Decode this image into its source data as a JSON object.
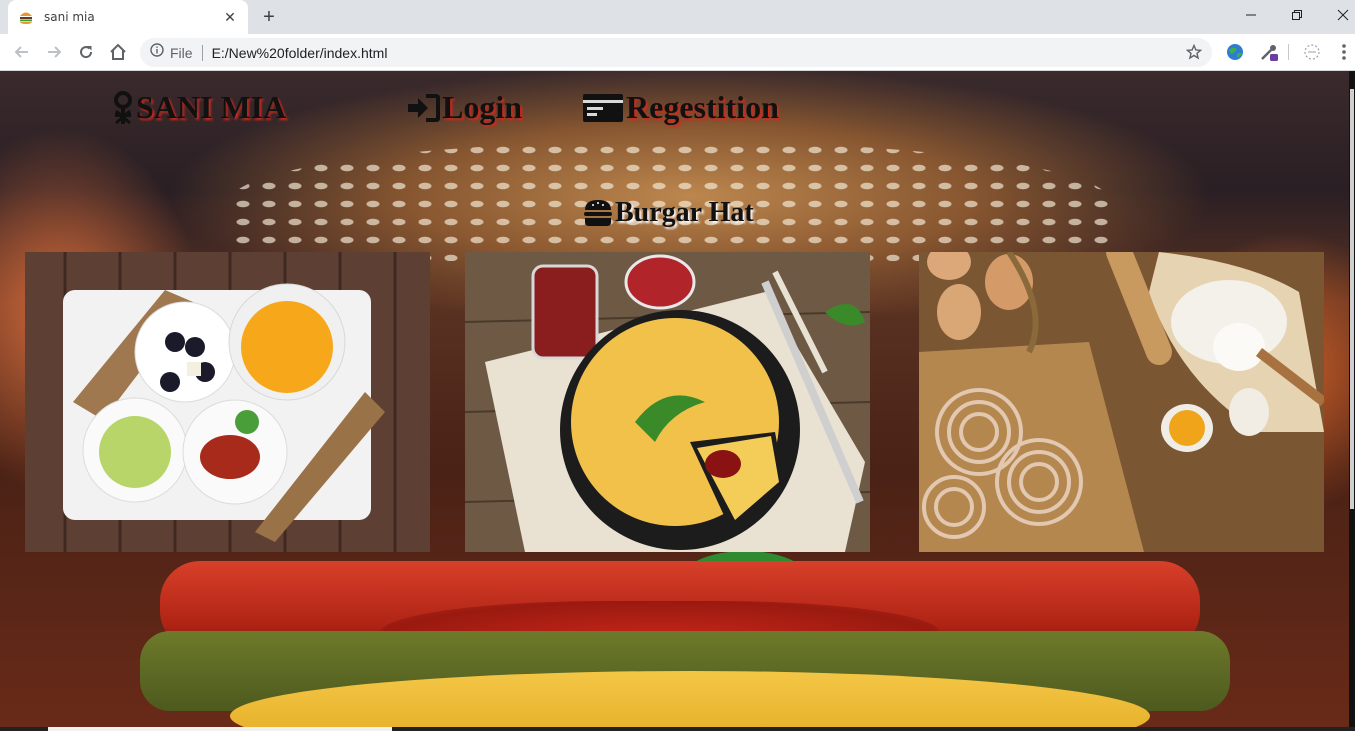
{
  "browser": {
    "tab_title": "sani mia",
    "new_tab": "+",
    "close_tab": "✕",
    "omnibox_scheme": "File",
    "url": "E:/New%20folder/index.html"
  },
  "site": {
    "brand": "SANI MIA",
    "nav_login": "Login",
    "nav_register": "Regestition",
    "section_title": "Burgar Hat"
  },
  "gallery": [
    {
      "name": "breakfast-plate",
      "colors": {
        "bg": "#6a4a3c",
        "plate": "#f4f4f4"
      }
    },
    {
      "name": "omelette-pan",
      "colors": {
        "bg": "#7c6248",
        "pan": "#1e1e1e"
      }
    },
    {
      "name": "pasta-eggs",
      "colors": {
        "bg": "#8a6440",
        "board": "#b88a56"
      }
    }
  ]
}
